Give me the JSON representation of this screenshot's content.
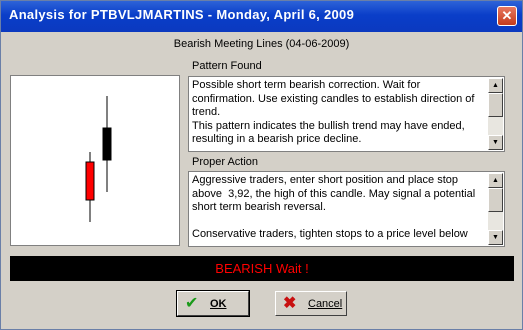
{
  "window": {
    "title": "Analysis for PTBVLJMARTINS - Monday, April 6, 2009",
    "close_icon": "close-icon"
  },
  "header": {
    "subtitle": "Bearish Meeting Lines (04-06-2009)"
  },
  "pattern": {
    "label": "Pattern Found",
    "text": "Possible short term bearish correction. Wait for confirmation. Use existing candles to establish direction of trend.\nThis pattern indicates the bullish trend may have ended, resulting in a bearish price decline."
  },
  "action": {
    "label": "Proper Action",
    "text": "Aggressive traders, enter short position and place stop above  3,92, the high of this candle. May signal a potential short term bearish reversal.\n\nConservative traders, tighten stops to a price level below"
  },
  "status": {
    "text": "BEARISH Wait !"
  },
  "buttons": {
    "ok_label": "OK",
    "cancel_label": "Cancel"
  },
  "colors": {
    "bearish_candle": "#ff0000",
    "bullish_candle": "#000000",
    "status_text": "#ff0000"
  }
}
